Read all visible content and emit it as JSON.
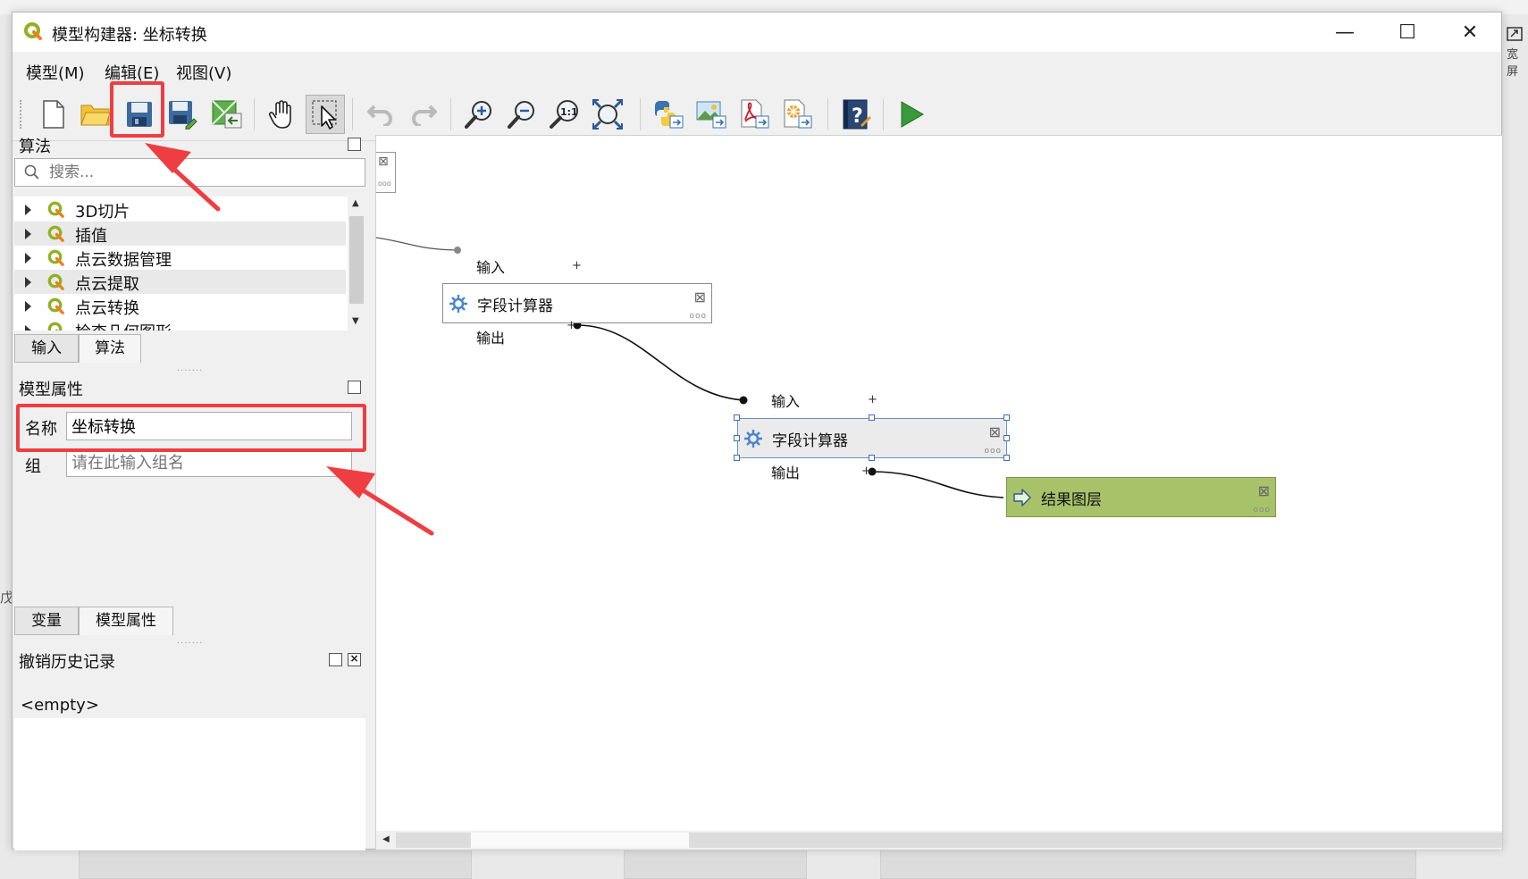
{
  "window": {
    "title": "模型构建器: 坐标转换",
    "controls": {
      "minimize": "—",
      "maximize": "☐",
      "close": "✕"
    }
  },
  "menu": [
    "模型(M)",
    "编辑(E)",
    "视图(V)"
  ],
  "toolbar": {
    "buttons": [
      "new-model",
      "open-model",
      "save-model",
      "save-as-model",
      "save-in-project",
      "pan",
      "select",
      "undo",
      "redo",
      "zoom-in",
      "zoom-out",
      "zoom-actual",
      "zoom-full",
      "export-python",
      "export-image",
      "export-pdf",
      "export-svg",
      "edit-help",
      "run-model"
    ]
  },
  "algorithms_panel": {
    "title": "算法",
    "search_placeholder": "搜索...",
    "items": [
      "3D切片",
      "插值",
      "点云数据管理",
      "点云提取",
      "点云转换",
      "检查几何图形"
    ],
    "tabs": [
      "输入",
      "算法"
    ]
  },
  "model_properties": {
    "title": "模型属性",
    "name_label": "名称",
    "name_value": "坐标转换",
    "group_label": "组",
    "group_placeholder": "请在此输入组名",
    "tabs": [
      "变量",
      "模型属性"
    ]
  },
  "undo_history": {
    "title": "撤销历史记录",
    "entries": [
      "<empty>"
    ]
  },
  "canvas": {
    "nodes": [
      {
        "label": "字段计算器",
        "input_label": "输入",
        "output_label": "输出"
      },
      {
        "label": "字段计算器",
        "input_label": "输入",
        "output_label": "输出"
      },
      {
        "label": "结果图层"
      }
    ]
  },
  "background": {
    "right_label": "宽屏",
    "left_char": "戊"
  },
  "colors": {
    "highlight": "#ee3e42",
    "output_node": "#a8c26a",
    "selection": "#3a6fbf"
  }
}
